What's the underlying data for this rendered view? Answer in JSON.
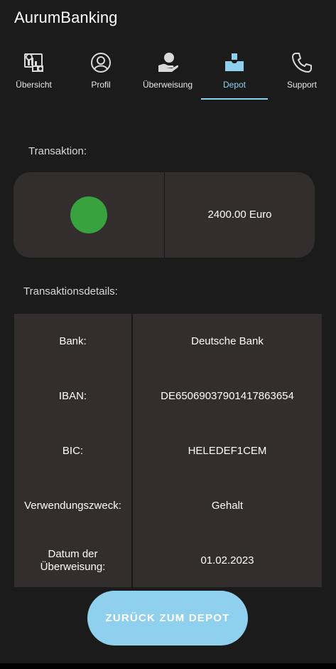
{
  "app": {
    "title": "AurumBanking"
  },
  "tabs": [
    {
      "label": "Übersicht",
      "icon": "overview-chart-icon"
    },
    {
      "label": "Profil",
      "icon": "profile-icon"
    },
    {
      "label": "Überweisung",
      "icon": "transfer-hand-icon"
    },
    {
      "label": "Depot",
      "icon": "depot-icon",
      "active": true
    },
    {
      "label": "Support",
      "icon": "phone-icon"
    }
  ],
  "transaction": {
    "heading": "Transaktion:",
    "status_color": "#37a23e",
    "amount": "2400.00 Euro"
  },
  "details": {
    "heading": "Transaktionsdetails:",
    "rows": [
      {
        "label": "Bank:",
        "value": "Deutsche Bank"
      },
      {
        "label": "IBAN:",
        "value": "DE65069037901417863654"
      },
      {
        "label": "BIC:",
        "value": "HELEDEF1CEM"
      },
      {
        "label": "Verwendungszweck:",
        "value": "Gehalt"
      },
      {
        "label": "Datum der Überweisung:",
        "value": "01.02.2023"
      }
    ]
  },
  "actions": {
    "back_label": "ZURÜCK ZUM DEPOT"
  },
  "colors": {
    "accent": "#8fd0ee",
    "background": "#1b1b1b",
    "card": "#312e2d"
  }
}
